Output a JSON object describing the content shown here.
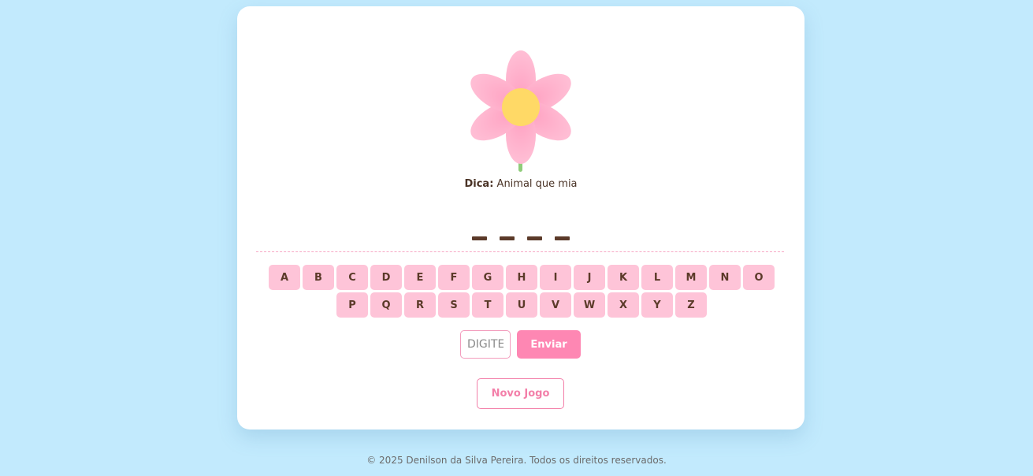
{
  "hint": {
    "label": "Dica:",
    "text": "Animal que mia"
  },
  "word": {
    "letters": [
      "",
      "",
      "",
      ""
    ]
  },
  "keyboard": {
    "row1": [
      "A",
      "B",
      "C",
      "D",
      "E",
      "F",
      "G",
      "H",
      "I",
      "J",
      "K",
      "L",
      "M",
      "N",
      "O"
    ],
    "row2": [
      "P",
      "Q",
      "R",
      "S",
      "T",
      "U",
      "V",
      "W",
      "X",
      "Y",
      "Z"
    ]
  },
  "guess": {
    "placeholder": "DIGITE",
    "send_label": "Enviar"
  },
  "actions": {
    "new_game_label": "Novo Jogo"
  },
  "footer": {
    "text": "© 2025 Denilson da Silva Pereira. Todos os direitos reservados."
  },
  "colors": {
    "background": "#c2eafd",
    "card": "#ffffff",
    "petal": "#ffa9c8",
    "flower_center": "#ffd966",
    "stem": "#8fcc7a",
    "key": "#fec4d8",
    "accent": "#fe87b3",
    "text": "#5b3a29"
  },
  "icons": {
    "flower": "flower-icon"
  }
}
